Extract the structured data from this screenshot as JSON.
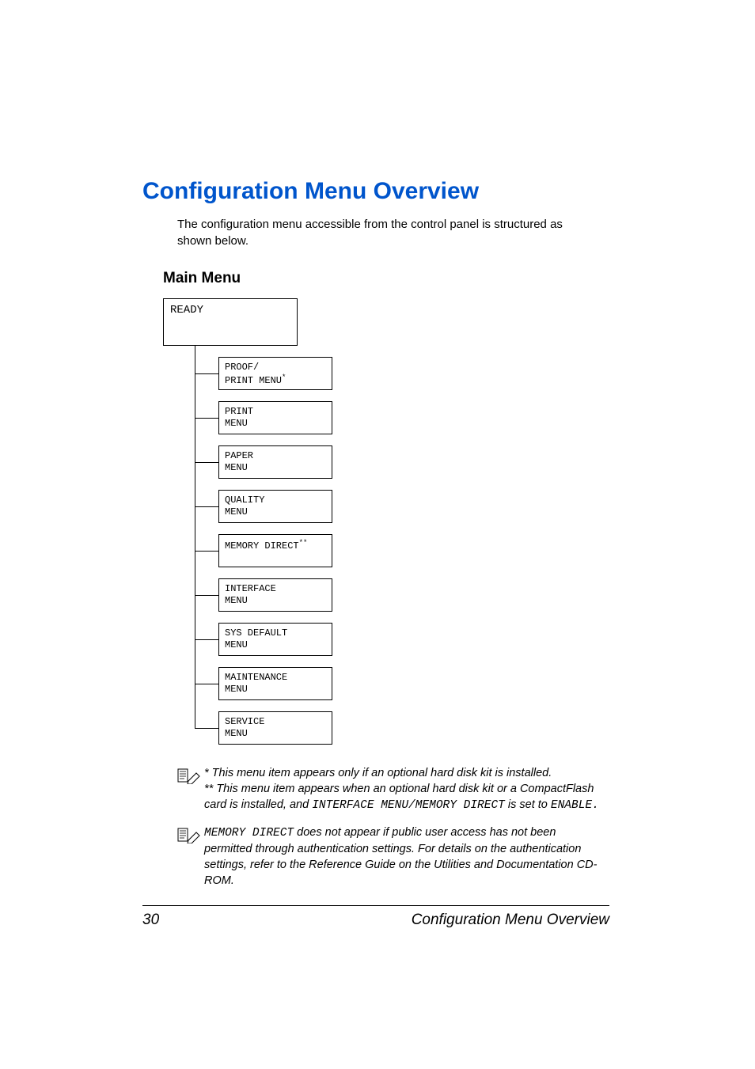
{
  "title": "Configuration Menu Overview",
  "intro": "The configuration menu accessible from the control panel is structured as shown below.",
  "subhead": "Main Menu",
  "diagram": {
    "ready": "READY",
    "items": [
      {
        "line1": "PROOF/",
        "line2": "PRINT MENU",
        "sup": "*"
      },
      {
        "line1": "PRINT",
        "line2": "MENU",
        "sup": ""
      },
      {
        "line1": "PAPER",
        "line2": "MENU",
        "sup": ""
      },
      {
        "line1": "QUALITY",
        "line2": "MENU",
        "sup": ""
      },
      {
        "line1": "MEMORY DIRECT",
        "line2": "",
        "sup": "**"
      },
      {
        "line1": "INTERFACE",
        "line2": "MENU",
        "sup": ""
      },
      {
        "line1": "SYS DEFAULT",
        "line2": "MENU",
        "sup": ""
      },
      {
        "line1": "MAINTENANCE",
        "line2": "MENU",
        "sup": ""
      },
      {
        "line1": "SERVICE",
        "line2": "MENU",
        "sup": ""
      }
    ]
  },
  "notes": {
    "n1a": "* This menu item appears only if an optional hard disk kit is installed.",
    "n1b": "** This menu item appears when an optional hard disk kit or a CompactFlash card is installed, and ",
    "n1c": "INTERFACE MENU/MEMORY DIRECT",
    "n1d": " is set to ",
    "n1e": "ENABLE.",
    "n2a": "MEMORY DIRECT",
    "n2b": " does not appear if public user access has not been permitted through authentication settings. For details on the authentication settings, refer to the Reference Guide on the Utilities and Documentation CD-ROM."
  },
  "footer": {
    "page_number": "30",
    "running_title": "Configuration Menu Overview"
  }
}
